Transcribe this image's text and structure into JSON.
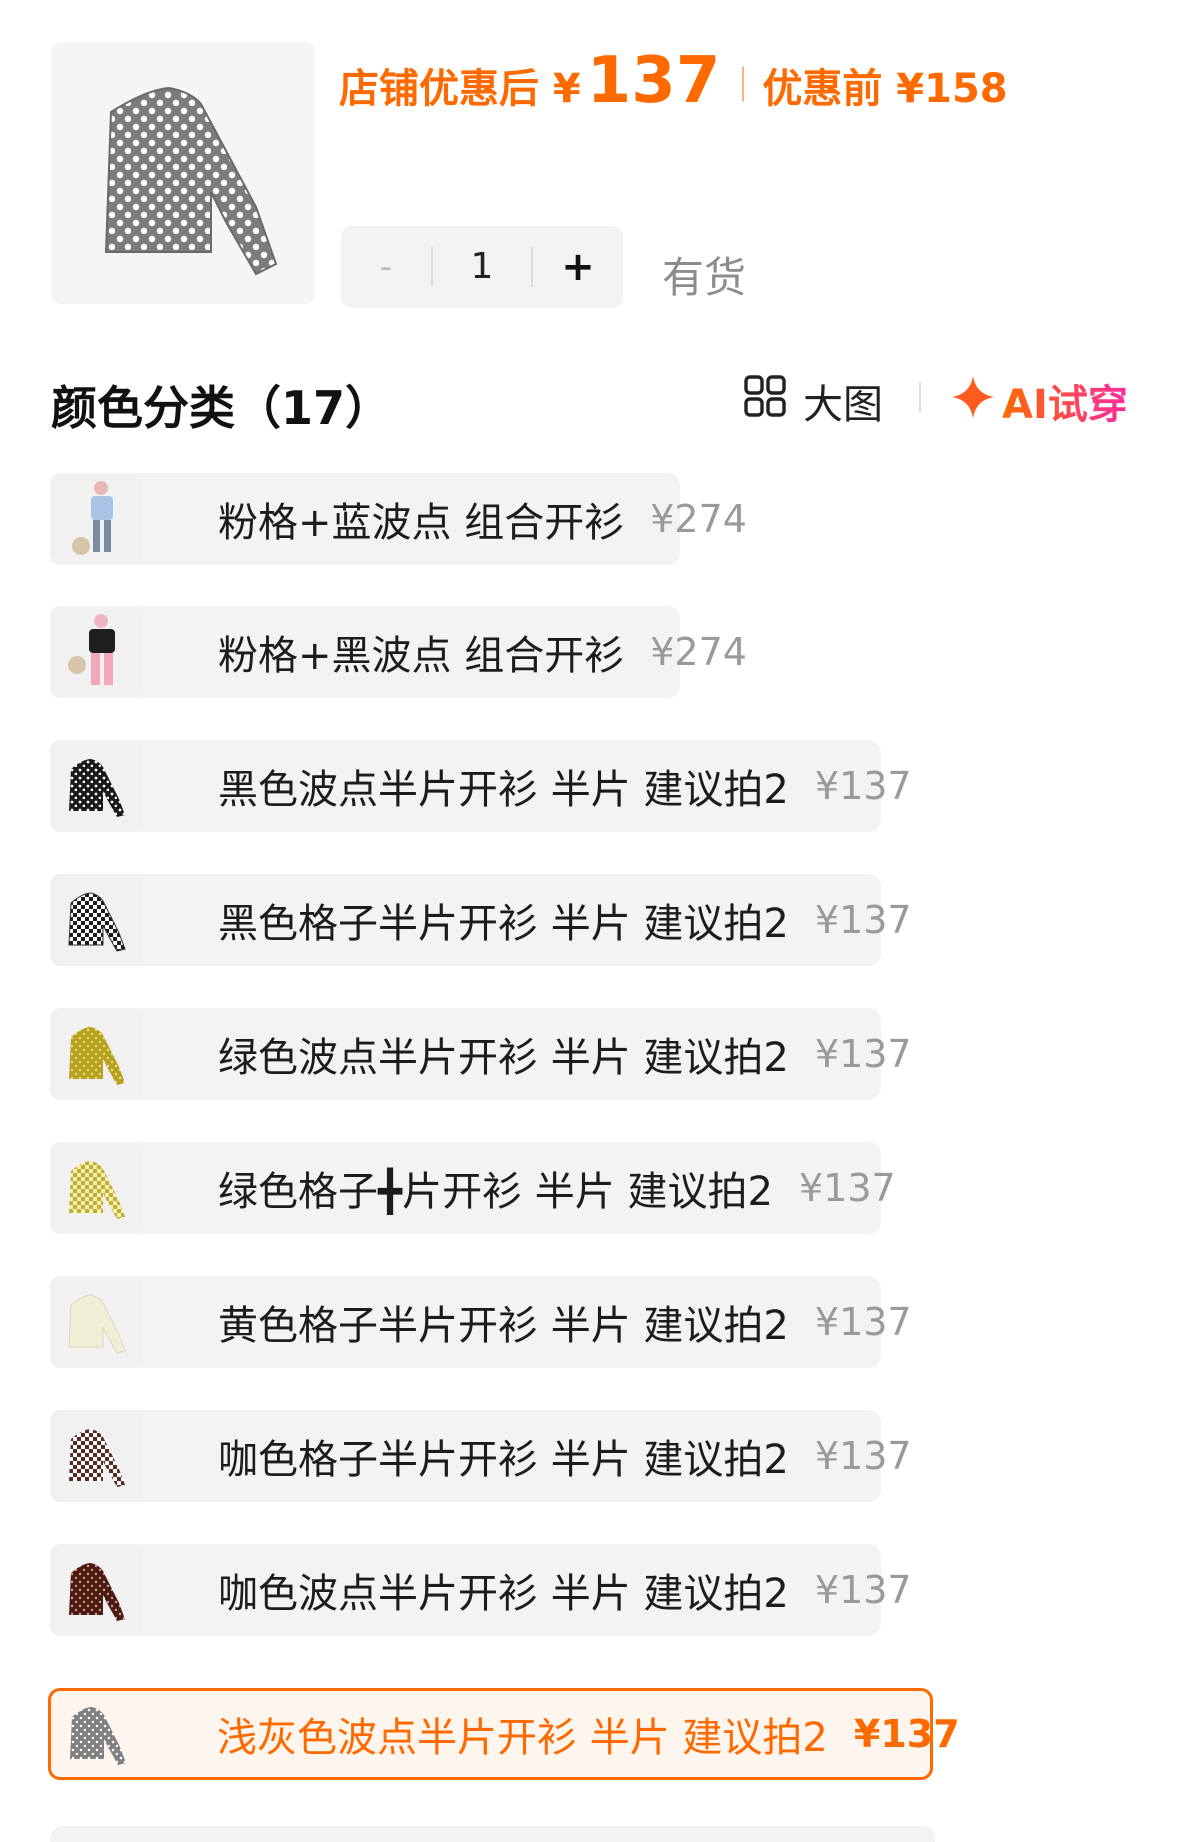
{
  "header": {
    "store_discount_label": "店铺优惠后 ¥",
    "store_discount_price": "137",
    "original_label": "优惠前 ¥158",
    "quantity_minus": "-",
    "quantity": "1",
    "quantity_plus": "+",
    "stock_status": "有货"
  },
  "section": {
    "title": "颜色分类（17）",
    "big_image_label": "大图",
    "ai_tryon_label": "AI试穿"
  },
  "colors": {
    "accent": "#ff6a00",
    "variant_bg": "#f3f3f3",
    "price_gray": "#9a9a9a"
  },
  "variants": [
    {
      "name": "粉格+蓝波点 组合开衫",
      "price": "¥274",
      "icon": "outfit-photo-icon"
    },
    {
      "name": "粉格+黑波点 组合开衫",
      "price": "¥274",
      "icon": "outfit-photo-icon"
    },
    {
      "name": "黑色波点半片开衫 半片 建议拍2",
      "price": "¥137",
      "icon": "polka-dot-cardigan-icon",
      "color": "#1a1a1a"
    },
    {
      "name": "黑色格子半片开衫 半片 建议拍2",
      "price": "¥137",
      "icon": "check-cardigan-icon",
      "color": "#1a1a1a"
    },
    {
      "name": "绿色波点半片开衫 半片 建议拍2",
      "price": "¥137",
      "icon": "polka-dot-cardigan-icon",
      "color": "#b9a21b"
    },
    {
      "name": "绿色格子╋片开衫 半片 建议拍2",
      "price": "¥137",
      "icon": "check-cardigan-icon",
      "color": "#c3ad2b"
    },
    {
      "name": "黄色格子半片开衫 半片 建议拍2",
      "price": "¥137",
      "icon": "check-cardigan-icon",
      "color": "#f1eed6"
    },
    {
      "name": "咖色格子半片开衫 半片 建议拍2",
      "price": "¥137",
      "icon": "check-cardigan-icon",
      "color": "#5a2a22"
    },
    {
      "name": "咖色波点半片开衫 半片 建议拍2",
      "price": "¥137",
      "icon": "polka-dot-cardigan-icon",
      "color": "#4d1a12"
    },
    {
      "name": "浅灰色波点半片开衫 半片 建议拍2",
      "price": "¥137",
      "icon": "polka-dot-cardigan-icon",
      "color": "#808080",
      "selected": true
    }
  ]
}
